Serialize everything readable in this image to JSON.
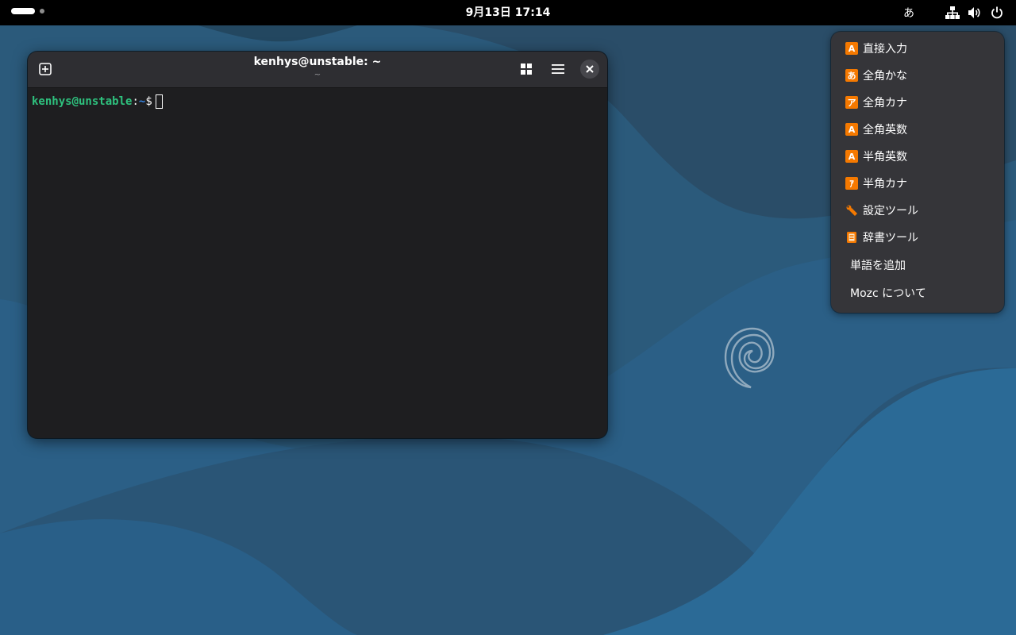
{
  "topbar": {
    "clock": "9月13日  17:14",
    "ime_indicator": "あ",
    "icons": [
      "network-icon",
      "volume-icon",
      "power-icon"
    ]
  },
  "terminal": {
    "title": "kenhys@unstable: ~",
    "subtitle": "~",
    "prompt": {
      "user_host": "kenhys@unstable",
      "colon": ":",
      "path": "~",
      "symbol": "$"
    }
  },
  "ime_menu": {
    "items": [
      {
        "label": "直接入力",
        "icon_glyph": "A"
      },
      {
        "label": "全角かな",
        "icon_glyph": "あ"
      },
      {
        "label": "全角カナ",
        "icon_glyph": "ア"
      },
      {
        "label": "全角英数",
        "icon_glyph": "A"
      },
      {
        "label": "半角英数",
        "icon_glyph": "A"
      },
      {
        "label": "半角カナ",
        "icon_glyph": "ｱ"
      },
      {
        "label": "設定ツール",
        "icon_glyph": ""
      },
      {
        "label": "辞書ツール",
        "icon_glyph": ""
      },
      {
        "label": "単語を追加",
        "icon_glyph": ""
      },
      {
        "label": "Mozc について",
        "icon_glyph": ""
      }
    ]
  },
  "colors": {
    "topbar": "#000000",
    "terminal_bg": "#1e1e20",
    "headerbar": "#2e2e32",
    "menu_bg": "#353539",
    "mozc_orange": "#f57900",
    "prompt_user": "#2ec27e",
    "prompt_path": "#3584e4"
  }
}
